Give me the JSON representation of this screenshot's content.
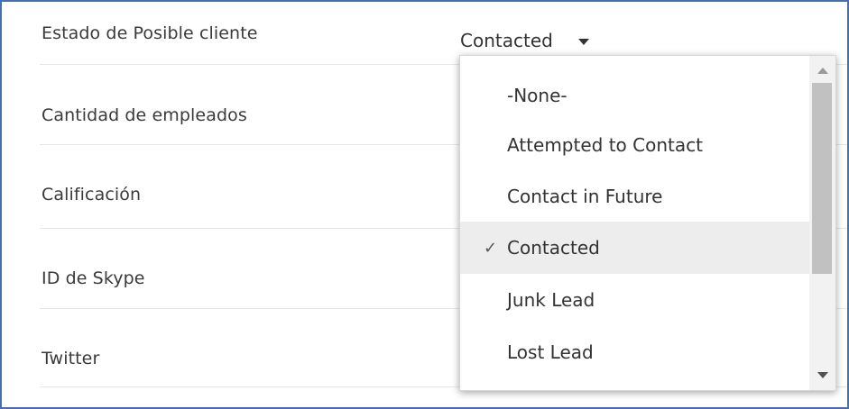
{
  "fields": [
    {
      "label": "Estado de Posible cliente"
    },
    {
      "label": "Cantidad de empleados"
    },
    {
      "label": "Calificación"
    },
    {
      "label": "ID de Skype"
    },
    {
      "label": "Twitter"
    }
  ],
  "lead_status_select": {
    "value": "Contacted",
    "caret_icon": "caret-down-icon"
  },
  "dropdown": {
    "options": [
      {
        "label": "-None-"
      },
      {
        "label": "Attempted to Contact"
      },
      {
        "label": "Contact in Future"
      },
      {
        "label": "Contacted",
        "check": "✓"
      },
      {
        "label": "Junk Lead"
      },
      {
        "label": "Lost Lead"
      }
    ],
    "selected_index": 3,
    "check_icon": "checkmark-icon"
  }
}
